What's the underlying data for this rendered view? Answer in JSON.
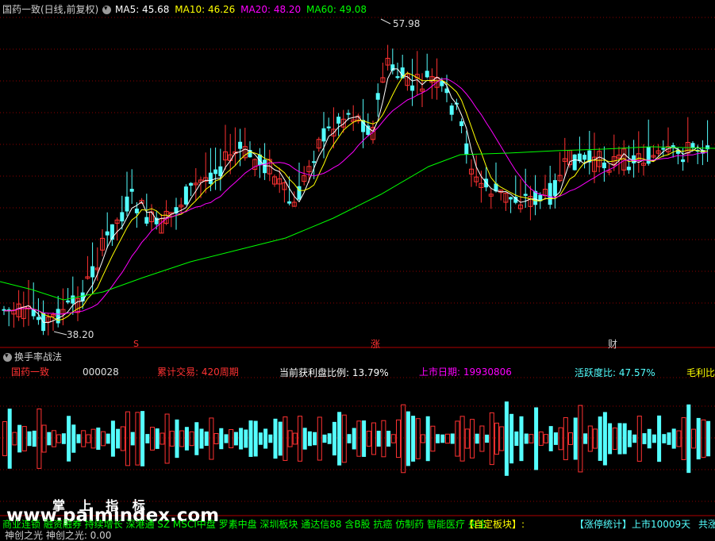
{
  "main": {
    "title": "国药一致(日线,前复权)",
    "ma": [
      {
        "label": "MA5: 45.68",
        "color": "#ffffff"
      },
      {
        "label": "MA10: 46.26",
        "color": "#ffff00"
      },
      {
        "label": "MA20: 48.20",
        "color": "#ff00ff"
      },
      {
        "label": "MA60: 49.08",
        "color": "#00ff00"
      }
    ],
    "high_label": "57.98",
    "low_label": "38.20",
    "markers": {
      "s": "S",
      "zhang": "涨",
      "cai": "财"
    }
  },
  "sub": {
    "title": "换手率战法",
    "stock": "国药一致",
    "code": "000028",
    "cum": "累计交易: 420周期",
    "profit": "当前获利盘比例: 13.79%",
    "list_date": "上市日期: 19930806",
    "active": "活跃度比: 47.57%",
    "margin": "毛利比"
  },
  "ticker": {
    "sectors": "商业连锁 融资融券 持续增长 深港通 SZ MSCI中盘 罗素中盘 深圳板块 通达信88 含B股 抗癌 仿制药 智能医疗 央企",
    "self_block": "【自定板块】:",
    "limit_stats": "【涨停统计】上市10009天",
    "tail": "共涨"
  },
  "bottom": {
    "label": "神创之光  神创之光: 0.00"
  },
  "watermark": {
    "cn": "掌 上 指 标",
    "url": "www.palmindex.com"
  },
  "colors": {
    "up": "#ff3232",
    "down": "#54ffff",
    "ma5": "#ffffff",
    "ma10": "#ffff00",
    "ma20": "#ff00ff",
    "ma60": "#00ff00",
    "bg": "#000000",
    "grid": "#8b0000"
  },
  "chart_data": {
    "type": "candlestick",
    "series_names": [
      "MA5",
      "MA10",
      "MA20",
      "MA60"
    ],
    "y_range": [
      37.0,
      58.6
    ],
    "visible_high": 57.98,
    "visible_low": 38.2,
    "ma_last": {
      "MA5": 45.68,
      "MA10": 46.26,
      "MA20": 48.2,
      "MA60": 49.08
    },
    "lower_indicator": "换手率战法"
  }
}
